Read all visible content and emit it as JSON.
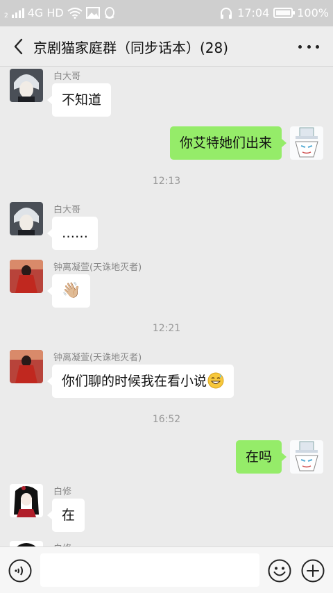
{
  "status_bar": {
    "network": "4G HD",
    "sim": "2",
    "time": "17:04",
    "battery": "100%",
    "battery_level": 1.0
  },
  "header": {
    "title": "京剧猫家庭群（同步话本）(28)",
    "back_icon": "chevron-left-icon",
    "more_icon": "more-dots-icon"
  },
  "messages": [
    {
      "type": "in",
      "sender": "白大哥",
      "text": "不知道",
      "avatar": "white-haired-boy-avatar"
    },
    {
      "type": "out",
      "text": "你艾特她们出来",
      "avatar": "white-cat-hat-avatar"
    },
    {
      "type": "time",
      "text": "12:13"
    },
    {
      "type": "in",
      "sender": "白大哥",
      "text": "……",
      "avatar": "white-haired-boy-avatar"
    },
    {
      "type": "in",
      "sender": "钟离凝萱(天诛地灭者)",
      "text": "👋🏼",
      "avatar": "red-dress-girl-avatar"
    },
    {
      "type": "time",
      "text": "12:21"
    },
    {
      "type": "in",
      "sender": "钟离凝萱(天诛地灭者)",
      "text": "你们聊的时候我在看小说",
      "emoji": "sweat-smile-emoji",
      "avatar": "red-dress-girl-avatar"
    },
    {
      "type": "time",
      "text": "16:52"
    },
    {
      "type": "out",
      "text": "在吗",
      "avatar": "white-cat-hat-avatar"
    },
    {
      "type": "in",
      "sender": "白修",
      "text": "在",
      "avatar": "black-haired-girl-avatar"
    },
    {
      "type": "in",
      "sender": "白修",
      "text": "",
      "avatar": "black-haired-girl-avatar"
    }
  ],
  "input_bar": {
    "placeholder": "",
    "voice_icon": "voice-icon",
    "emoji_icon": "emoji-icon",
    "plus_icon": "add-icon"
  },
  "colors": {
    "outgoing_bubble": "#95ec69",
    "incoming_bubble": "#ffffff",
    "background": "#ebebeb"
  }
}
